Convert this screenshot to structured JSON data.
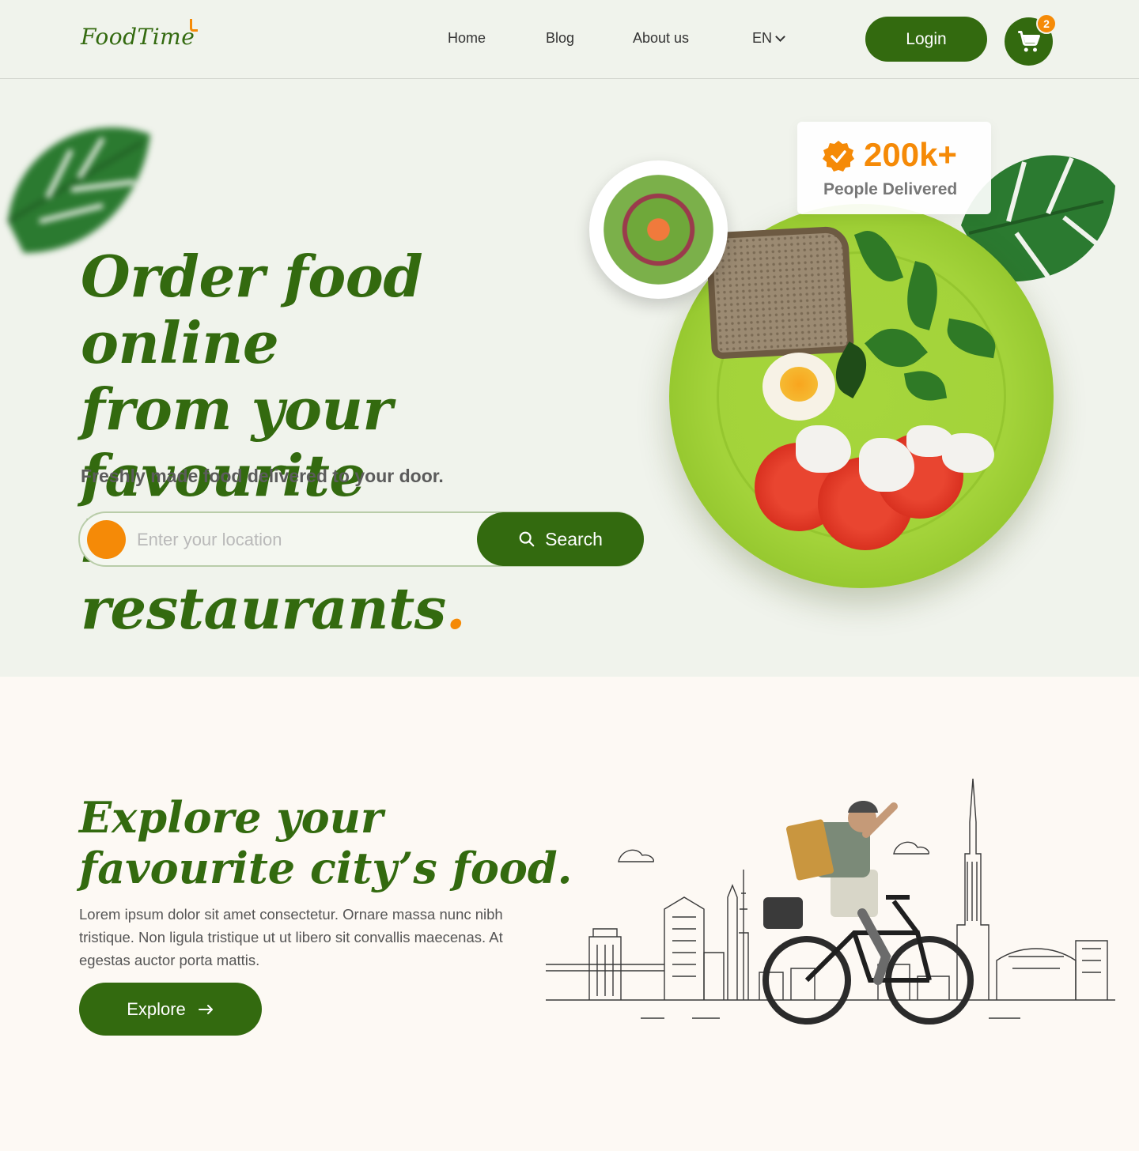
{
  "brand": {
    "name": "FoodTime",
    "accent": "#f58a07",
    "primary": "#336a0f"
  },
  "nav": {
    "home": "Home",
    "blog": "Blog",
    "about": "About us",
    "language": "EN",
    "login": "Login",
    "cart_count": "2",
    "cart_icon": "cart-icon"
  },
  "hero": {
    "title_line1": "Order food online",
    "title_line2": "from your favourite",
    "title_line3": "local restaurants",
    "title_dot": ".",
    "subtitle": "Freshly made food delivered to your door.",
    "location_placeholder": "Enter your location",
    "search_label": "Search",
    "search_icon": "search-icon",
    "stat_value": "200k+",
    "stat_label": "People Delivered",
    "stat_icon": "verified-check-icon"
  },
  "explore": {
    "title_line1": "Explore your",
    "title_line2": "favourite city’s food.",
    "description": "Lorem ipsum dolor sit amet consectetur. Ornare massa nunc nibh tristique. Non ligula tristique ut ut libero sit convallis maecenas. At egestas auctor porta mattis.",
    "button_label": "Explore",
    "button_icon": "arrow-right-icon"
  }
}
